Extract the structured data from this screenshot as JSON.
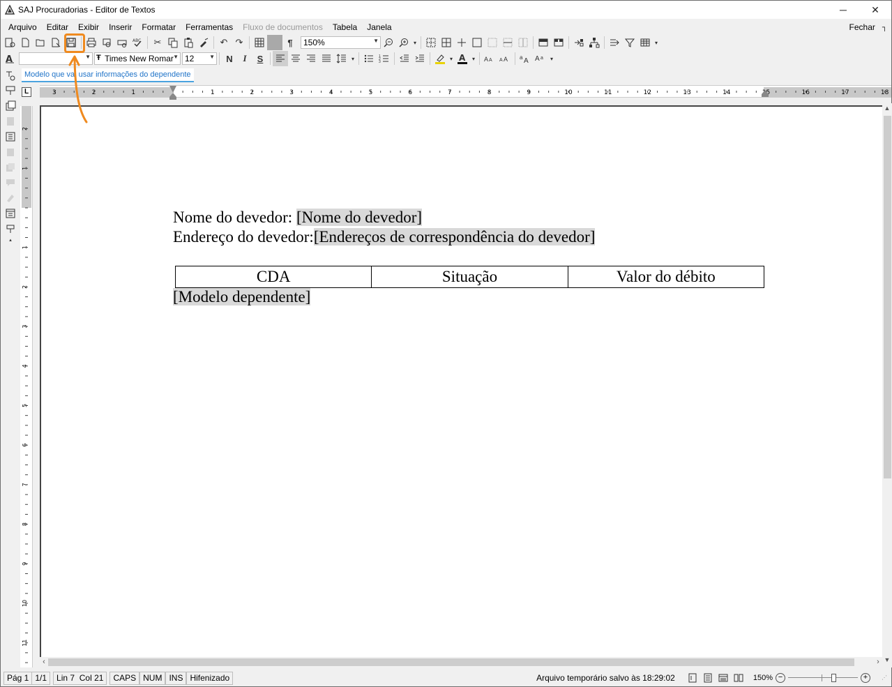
{
  "window": {
    "title": "SAJ Procuradorias - Editor de Textos"
  },
  "menu": {
    "items": [
      {
        "label": "Arquivo",
        "enabled": true
      },
      {
        "label": "Editar",
        "enabled": true
      },
      {
        "label": "Exibir",
        "enabled": true
      },
      {
        "label": "Inserir",
        "enabled": true
      },
      {
        "label": "Formatar",
        "enabled": true
      },
      {
        "label": "Ferramentas",
        "enabled": true
      },
      {
        "label": "Fluxo de documentos",
        "enabled": false
      },
      {
        "label": "Tabela",
        "enabled": true
      },
      {
        "label": "Janela",
        "enabled": true
      }
    ],
    "close_label": "Fechar"
  },
  "toolbar": {
    "zoom_value": "150%",
    "style_value": "",
    "font_value": "Times New Romar",
    "font_size_value": "12",
    "bold_label": "N",
    "italic_label": "I",
    "underline_label": "S",
    "pilcrow": "¶",
    "accent_color": "#ef8a1f"
  },
  "document": {
    "tab_label": "Modelo que vai usar informações do dependente",
    "line1_label": "Nome do devedor: ",
    "line1_field": "[Nome do devedor]",
    "line2_label": "Endereço do devedor:",
    "line2_field": "[Endereços de correspondência do devedor]",
    "table_headers": [
      "CDA",
      "Situação",
      "Valor do débito"
    ],
    "dependent_field": "[Modelo dependente]"
  },
  "ruler": {
    "h_labels": [
      "3",
      "2",
      "1",
      "1",
      "2",
      "3",
      "4",
      "5",
      "6",
      "7",
      "8",
      "9",
      "10",
      "11",
      "12",
      "13",
      "14",
      "15",
      "16",
      "17",
      "18"
    ],
    "v_labels": [
      "2",
      "1",
      "1",
      "2",
      "3",
      "4",
      "5",
      "6",
      "7",
      "8",
      "9",
      "10",
      "11"
    ]
  },
  "status": {
    "page": "Pág 1",
    "pages": "1/1",
    "position": "Lin 7  Col 21",
    "caps": "CAPS",
    "num": "NUM",
    "ins": "INS",
    "hyphen": "Hifenizado",
    "saved_msg": "Arquivo temporário salvo às 18:29:02",
    "zoom": "150%"
  }
}
